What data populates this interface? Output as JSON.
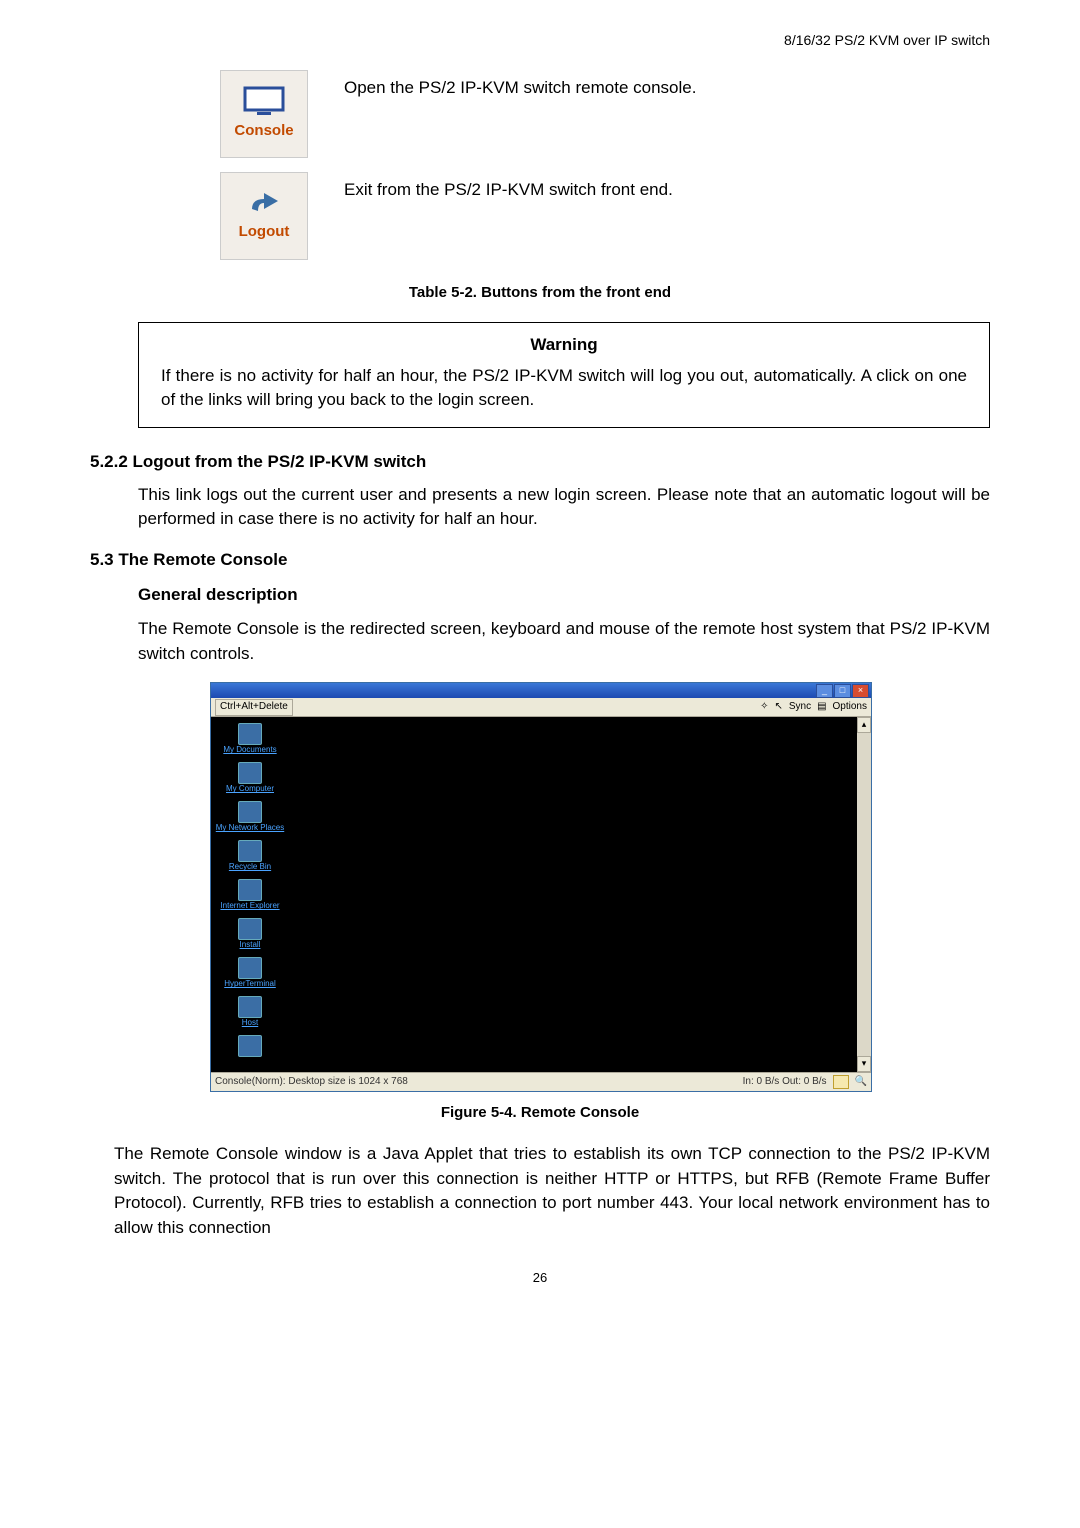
{
  "header": {
    "doc_title": "8/16/32 PS/2 KVM over IP switch"
  },
  "icons": {
    "console": {
      "label": "Console",
      "desc": "Open the PS/2 IP-KVM switch remote console."
    },
    "logout": {
      "label": "Logout",
      "desc": "Exit from the PS/2 IP-KVM switch front end."
    }
  },
  "table_caption": "Table 5-2. Buttons from the front end",
  "warning": {
    "title": "Warning",
    "body": "If there is no activity for half an hour, the PS/2 IP-KVM switch will log you out, automatically. A click on one of the links will bring you back to the login screen."
  },
  "sec522": {
    "heading": "5.2.2  Logout from the PS/2 IP-KVM switch",
    "body": "This link logs out the current user and presents a new login screen. Please note that an automatic logout will be performed in case there is no activity for half an hour."
  },
  "sec53": {
    "heading": "5.3 The Remote Console",
    "sub": "General description",
    "body": "The Remote Console is the redirected screen, keyboard and mouse of the remote host system that PS/2 IP-KVM switch controls."
  },
  "remote_console": {
    "toolbar": {
      "cad": "Ctrl+Alt+Delete",
      "sync": "Sync",
      "options": "Options"
    },
    "desktop_items": [
      "My Documents",
      "My Computer",
      "My Network Places",
      "Recycle Bin",
      "Internet Explorer",
      "Install",
      "HyperTerminal",
      "Host",
      ""
    ],
    "status_left": "Console(Norm): Desktop size is 1024 x 768",
    "status_right": "In: 0 B/s Out: 0 B/s"
  },
  "figure_caption": "Figure 5-4. Remote Console",
  "post_figure_body": "The Remote Console window is a Java Applet that tries to establish its own TCP connection to the PS/2 IP-KVM switch. The protocol that is run over this connection is neither HTTP or HTTPS, but RFB (Remote Frame Buffer Protocol). Currently, RFB tries to establish a connection to port number 443. Your local network environment has to allow this connection",
  "page_number": "26"
}
